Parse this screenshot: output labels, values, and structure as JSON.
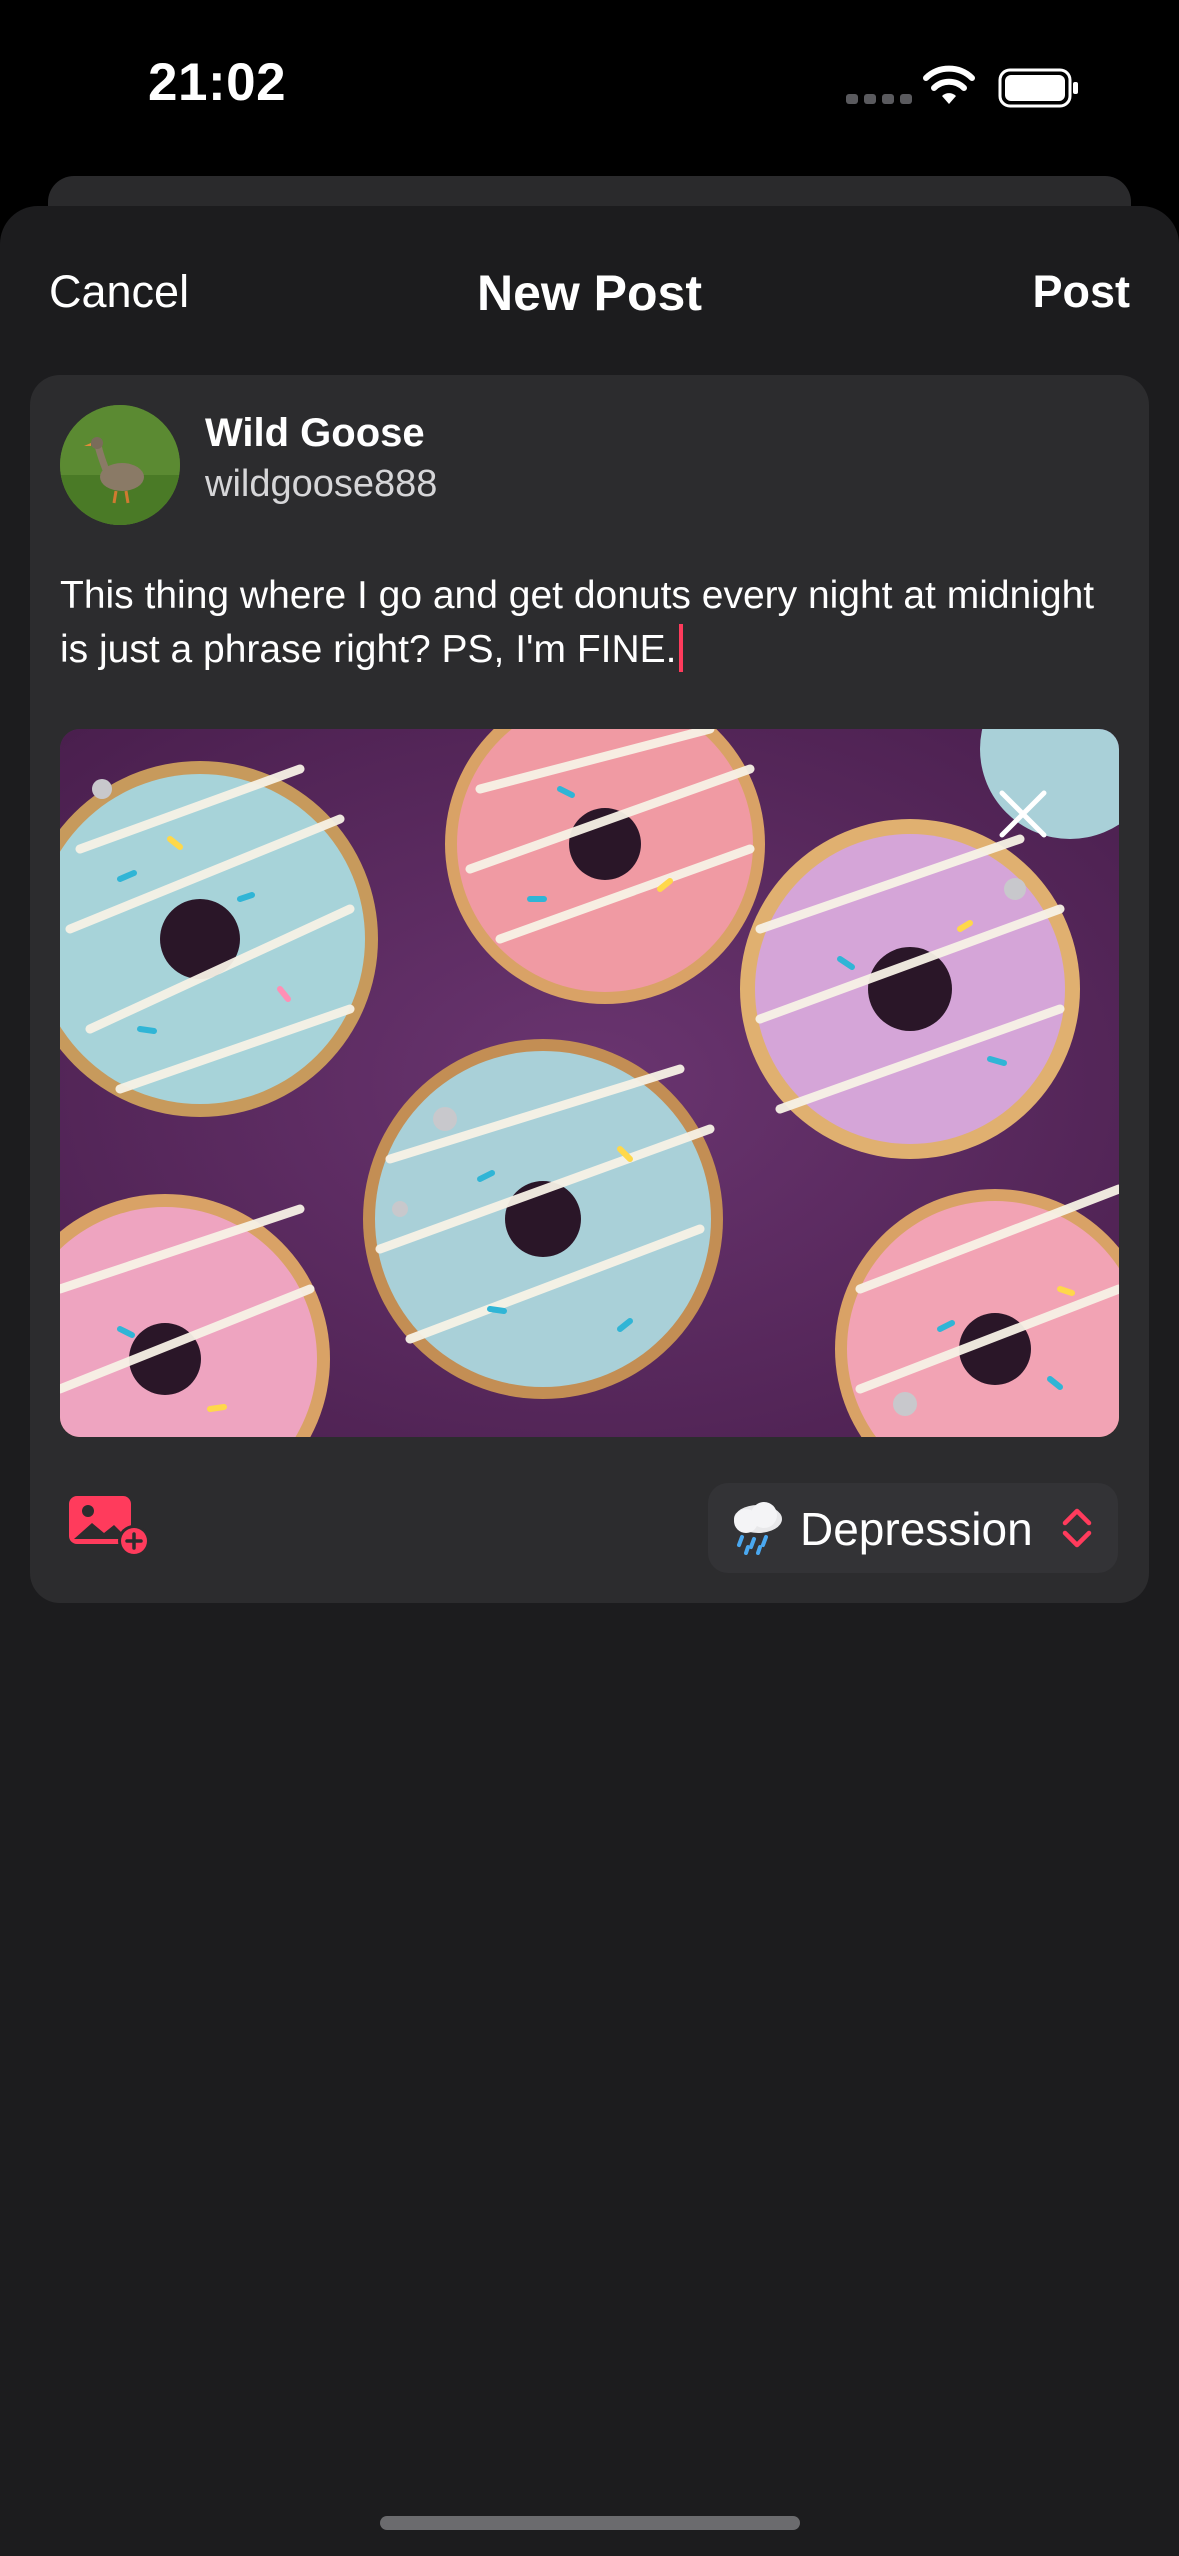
{
  "status_bar": {
    "time": "21:02",
    "icons": [
      "cellular-dots-icon",
      "wifi-icon",
      "battery-icon"
    ]
  },
  "nav": {
    "cancel_label": "Cancel",
    "title": "New Post",
    "post_label": "Post"
  },
  "author": {
    "display_name": "Wild Goose",
    "handle": "wildgoose888"
  },
  "post": {
    "text": "This thing where I go and get donuts every night at midnight is just a phrase right? PS, I'm FINE."
  },
  "attachment": {
    "icon": "close-icon"
  },
  "toolbar": {
    "add_image_icon": "image-add-icon",
    "mood_label": "Depression",
    "mood_icon": "rain-cloud-icon"
  },
  "colors": {
    "accent": "#ff3b5c",
    "background": "#1c1c1e",
    "card": "#2c2c2e"
  }
}
